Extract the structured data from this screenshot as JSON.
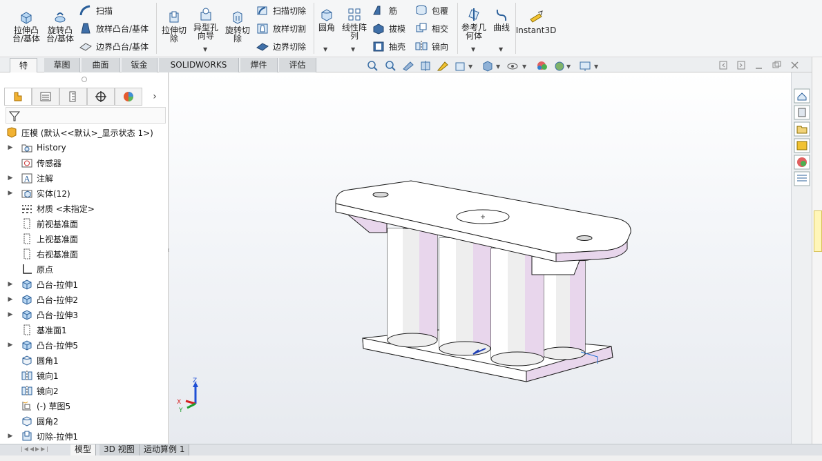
{
  "ribbon": {
    "extrude_boss": "拉伸凸\n台/基体",
    "revolve_boss": "旋转凸\n台/基体",
    "sweep": "扫描",
    "loft_boss": "放样凸台/基体",
    "boundary_boss": "边界凸台/基体",
    "extrude_cut": "拉伸切\n除",
    "hole_wizard": "异型孔\n向导",
    "revolve_cut": "旋转切\n除",
    "sweep_cut": "扫描切除",
    "loft_cut": "放样切割",
    "boundary_cut": "边界切除",
    "fillet": "圆角",
    "linear_pattern": "线性阵\n列",
    "rib": "筋",
    "draft": "拔模",
    "shell": "抽壳",
    "wrap": "包覆",
    "intersect": "相交",
    "mirror": "镜向",
    "ref_geometry": "参考几\n何体",
    "curves": "曲线",
    "instant3d": "Instant3D"
  },
  "tabs": [
    {
      "label": "特征",
      "active": true
    },
    {
      "label": "草图"
    },
    {
      "label": "曲面"
    },
    {
      "label": "钣金"
    },
    {
      "label": "SOLIDWORKS MBD"
    },
    {
      "label": "焊件(D)"
    },
    {
      "label": "评估"
    }
  ],
  "tree": {
    "root": "压模 (默认<<默认>_显示状态 1>)",
    "items": [
      {
        "label": "History",
        "icon": "history-folder-icon",
        "expand": true
      },
      {
        "label": "传感器",
        "icon": "sensor-icon",
        "expand": false
      },
      {
        "label": "注解",
        "icon": "annotation-icon",
        "expand": true
      },
      {
        "label": "实体(12)",
        "icon": "solid-bodies-icon",
        "expand": true
      },
      {
        "label": "材质 <未指定>",
        "icon": "material-icon",
        "expand": false
      },
      {
        "label": "前视基准面",
        "icon": "plane-icon",
        "expand": false
      },
      {
        "label": "上视基准面",
        "icon": "plane-icon",
        "expand": false
      },
      {
        "label": "右视基准面",
        "icon": "plane-icon",
        "expand": false
      },
      {
        "label": "原点",
        "icon": "origin-icon",
        "expand": false
      },
      {
        "label": "凸台-拉伸1",
        "icon": "extrude-icon",
        "expand": true
      },
      {
        "label": "凸台-拉伸2",
        "icon": "extrude-icon",
        "expand": true
      },
      {
        "label": "凸台-拉伸3",
        "icon": "extrude-icon",
        "expand": true
      },
      {
        "label": "基准面1",
        "icon": "plane-icon",
        "expand": false
      },
      {
        "label": "凸台-拉伸5",
        "icon": "extrude-icon",
        "expand": true
      },
      {
        "label": "圆角1",
        "icon": "fillet-icon",
        "expand": false
      },
      {
        "label": "镜向1",
        "icon": "mirror-icon",
        "expand": false
      },
      {
        "label": "镜向2",
        "icon": "mirror-icon",
        "expand": false
      },
      {
        "label": "(-) 草图5",
        "icon": "sketch-icon",
        "expand": false
      },
      {
        "label": "圆角2",
        "icon": "fillet-icon",
        "expand": false
      },
      {
        "label": "切除-拉伸1",
        "icon": "cut-extrude-icon",
        "expand": true
      }
    ]
  },
  "bottom_tabs": [
    {
      "label": "模型",
      "active": true
    },
    {
      "label": "3D 视图"
    },
    {
      "label": "运动算例 1"
    }
  ],
  "triad": {
    "x": "X",
    "y": "Y",
    "z": "Z"
  },
  "colors": {
    "accent": "#1f6fb5",
    "body_pink": "#e8d6ec",
    "edge": "#1b1b1b"
  }
}
